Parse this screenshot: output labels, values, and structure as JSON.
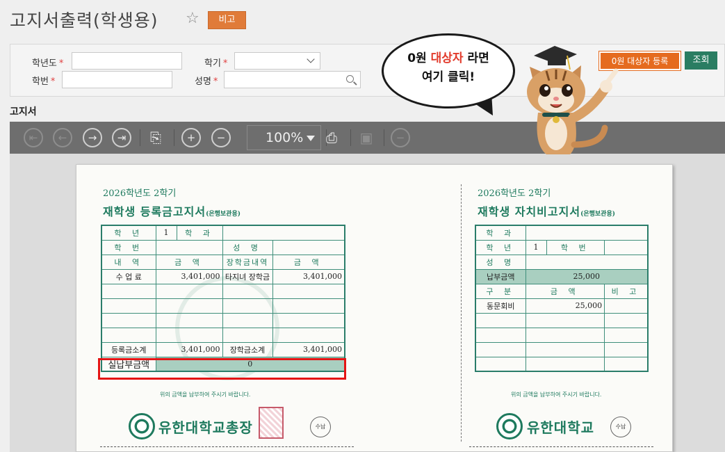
{
  "header": {
    "title": "고지서출력(학생용)",
    "memo_label": "비고"
  },
  "search": {
    "year_label": "학년도",
    "term_label": "학기",
    "student_id_label": "학번",
    "name_label": "성명",
    "year_value": "",
    "term_value": "",
    "student_id_value": "",
    "name_value": ""
  },
  "actions": {
    "zero_register_label": "0원 대상자 등록",
    "query_label": "조회"
  },
  "callout": {
    "line1_prefix": "0원 ",
    "line1_emphasis": "대상자",
    "line1_suffix": " 라면",
    "line2": "여기 클릭!"
  },
  "section": {
    "title": "고지서"
  },
  "viewer": {
    "zoom": "100%"
  },
  "invoice_left": {
    "year_term": "2026학년도  2학기",
    "title": "재학생 등록금고지서",
    "title_suffix": "(은행보관용)",
    "grade_label": "학    년",
    "grade_value": "1",
    "dept_label": "학    과",
    "id_label": "학    번",
    "name_label": "성    명",
    "col_item": "내    역",
    "col_amount": "금    액",
    "col_scholar": "장학금내역",
    "col_amount2": "금    액",
    "row1_item": "수 업 료",
    "row1_amount": "3,401,000",
    "row1_scholar": "타지녀 장학금",
    "row1_amount2": "3,401,000",
    "subtotal_label": "등록금소계",
    "subtotal_value": "3,401,000",
    "scholar_total_label": "장학금소계",
    "scholar_total_value": "3,401,000",
    "net_label": "실납부금액",
    "net_value": "0",
    "notice": "위의 금액을 납부하여 주시기 바랍니다.",
    "university": "유한대학교총장",
    "receipt_mark": "수납"
  },
  "invoice_right": {
    "year_term": "2026학년도  2학기",
    "title": "재학생 자치비고지서",
    "title_suffix": "(은행보관용)",
    "dept_label": "학    과",
    "grade_label": "학    년",
    "grade_value": "1",
    "id_label": "학    번",
    "name_label": "성    명",
    "pay_label": "납부금액",
    "pay_value": "25,000",
    "col_category": "구    분",
    "col_amount": "금    액",
    "col_note": "비    고",
    "row1_item": "동문회비",
    "row1_amount": "25,000",
    "notice": "위의 금액을 납부하여 주시기 바랍니다.",
    "university": "유한대학교",
    "receipt_mark": "수납"
  },
  "colors": {
    "accent_orange": "#e56b1f",
    "query_green": "#2a7d62",
    "invoice_green": "#1e7a5e",
    "highlight_red": "#e41414"
  }
}
